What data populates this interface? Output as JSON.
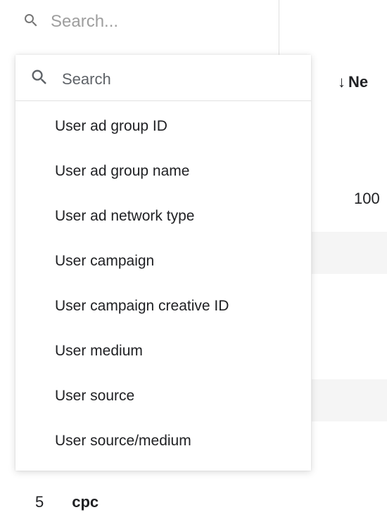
{
  "top_search": {
    "placeholder": "Search..."
  },
  "dropdown": {
    "search_label": "Search",
    "items": [
      "User ad group ID",
      "User ad group name",
      "User ad network type",
      "User campaign",
      "User campaign creative ID",
      "User medium",
      "User source",
      "User source/medium"
    ]
  },
  "column_header": {
    "sort_arrow": "↓",
    "label": "Ne"
  },
  "cells": {
    "val_100": "100"
  },
  "bottom_row": {
    "index": "5",
    "value": "cpc"
  }
}
